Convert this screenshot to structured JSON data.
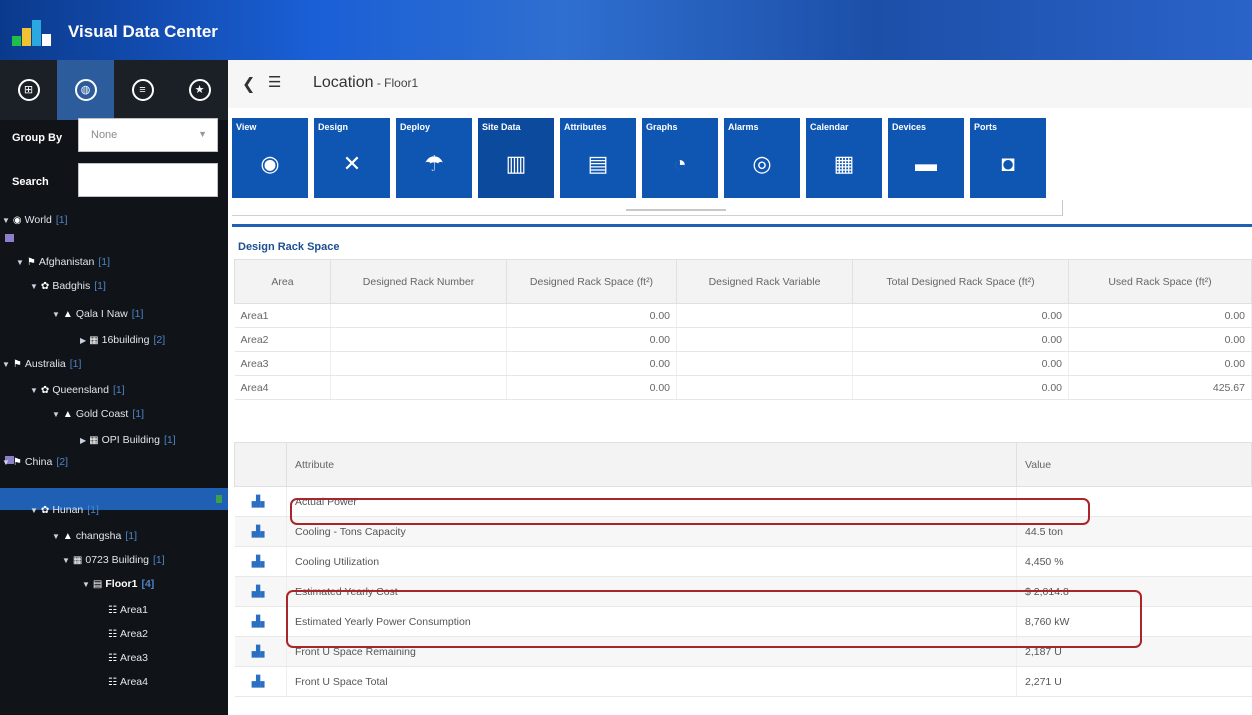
{
  "app": {
    "title": "Visual Data Center",
    "logo_colors": [
      "#1ec04a",
      "#f1c232",
      "#2aa8e0",
      "#ffffff"
    ]
  },
  "sidebar": {
    "tabs": [
      {
        "icon": "grid-circle-icon",
        "glyph": "⊞",
        "active": false
      },
      {
        "icon": "globe-circle-icon",
        "glyph": "◍",
        "active": true
      },
      {
        "icon": "list-circle-icon",
        "glyph": "≡",
        "active": false
      },
      {
        "icon": "star-circle-icon",
        "glyph": "★",
        "active": false
      }
    ],
    "group_by_label": "Group By",
    "group_by_value": "None",
    "search_label": "Search",
    "search_value": "",
    "tree": [
      {
        "label": "World",
        "count": "[1]",
        "toggle": "▼",
        "icon": "◉",
        "level": 0
      },
      {
        "label": "Afghanistan",
        "count": "[1]",
        "toggle": "▼",
        "icon": "⚑",
        "level": 1
      },
      {
        "label": "Badghis",
        "count": "[1]",
        "toggle": "▼",
        "icon": "✿",
        "level": 2
      },
      {
        "label": "Qala I Naw",
        "count": "[1]",
        "toggle": "▼",
        "icon": "▲",
        "level": 3
      },
      {
        "label": "16building",
        "count": "[2]",
        "toggle": "▶",
        "icon": "▦",
        "level": 4
      },
      {
        "label": "Australia",
        "count": "[1]",
        "toggle": "▼",
        "icon": "⚑",
        "level": 1
      },
      {
        "label": "Queensland",
        "count": "[1]",
        "toggle": "▼",
        "icon": "✿",
        "level": 2
      },
      {
        "label": "Gold Coast",
        "count": "[1]",
        "toggle": "▼",
        "icon": "▲",
        "level": 3
      },
      {
        "label": "OPI Building",
        "count": "[1]",
        "toggle": "▶",
        "icon": "▦",
        "level": 4
      },
      {
        "label": "China",
        "count": "[2]",
        "toggle": "▼",
        "icon": "⚑",
        "level": 1
      },
      {
        "label": "Hunan",
        "count": "[1]",
        "toggle": "▼",
        "icon": "✿",
        "level": 2
      },
      {
        "label": "changsha",
        "count": "[1]",
        "toggle": "▼",
        "icon": "▲",
        "level": 3
      },
      {
        "label": "0723 Building",
        "count": "[1]",
        "toggle": "▼",
        "icon": "▦",
        "level": 4
      },
      {
        "label": "Floor1",
        "count": "[4]",
        "toggle": "▼",
        "icon": "▤",
        "level": 5,
        "selected": true
      },
      {
        "label": "Area1",
        "count": "",
        "toggle": "",
        "icon": "☷",
        "level": 6
      },
      {
        "label": "Area2",
        "count": "",
        "toggle": "",
        "icon": "☷",
        "level": 6
      },
      {
        "label": "Area3",
        "count": "",
        "toggle": "",
        "icon": "☷",
        "level": 6
      },
      {
        "label": "Area4",
        "count": "",
        "toggle": "",
        "icon": "☷",
        "level": 6
      }
    ]
  },
  "topbar": {
    "title": "Location",
    "separator": " - ",
    "subtitle": "Floor1"
  },
  "toolbar": [
    {
      "label": "View",
      "icon": "eye-icon",
      "glyph": "◉"
    },
    {
      "label": "Design",
      "icon": "tools-icon",
      "glyph": "✕"
    },
    {
      "label": "Deploy",
      "icon": "parachute-icon",
      "glyph": "☂"
    },
    {
      "label": "Site Data",
      "icon": "site-data-icon",
      "glyph": "▥",
      "active": true
    },
    {
      "label": "Attributes",
      "icon": "attributes-icon",
      "glyph": "▤"
    },
    {
      "label": "Graphs",
      "icon": "gauge-icon",
      "glyph": "◔"
    },
    {
      "label": "Alarms",
      "icon": "alarm-icon",
      "glyph": "◎"
    },
    {
      "label": "Calendar",
      "icon": "calendar-icon",
      "glyph": "▦"
    },
    {
      "label": "Devices",
      "icon": "devices-icon",
      "glyph": "▬"
    },
    {
      "label": "Ports",
      "icon": "ports-icon",
      "glyph": "◘"
    }
  ],
  "rack": {
    "title": "Design Rack Space",
    "columns": [
      "Area",
      "Designed Rack Number",
      "Designed Rack Space (ft²)",
      "Designed Rack Variable",
      "Total Designed Rack Space (ft²)",
      "Used Rack Space (ft²)"
    ],
    "rows": [
      [
        "Area1",
        "",
        "0.00",
        "",
        "0.00",
        "0.00"
      ],
      [
        "Area2",
        "",
        "0.00",
        "",
        "0.00",
        "0.00"
      ],
      [
        "Area3",
        "",
        "0.00",
        "",
        "0.00",
        "0.00"
      ],
      [
        "Area4",
        "",
        "0.00",
        "",
        "0.00",
        "425.67"
      ]
    ]
  },
  "attributes": {
    "columns": [
      "",
      "Attribute",
      "Value"
    ],
    "rows": [
      {
        "name": "Actual Power",
        "value": ""
      },
      {
        "name": "Cooling - Tons Capacity",
        "value": "44.5 ton"
      },
      {
        "name": "Cooling Utilization",
        "value": "4,450 %"
      },
      {
        "name": "Estimated Yearly Cost",
        "value": "$ 2,014.8"
      },
      {
        "name": "Estimated Yearly Power Consumption",
        "value": "8,760 kW"
      },
      {
        "name": "Front U Space Remaining",
        "value": "2,187 U"
      },
      {
        "name": "Front U Space Total",
        "value": "2,271 U"
      }
    ]
  },
  "colors": {
    "toolbar_blue": "#0f56b3",
    "highlight_red": "#a8262a",
    "sidebar_bg": "#101418",
    "selected_blue": "#1f5fb4"
  }
}
